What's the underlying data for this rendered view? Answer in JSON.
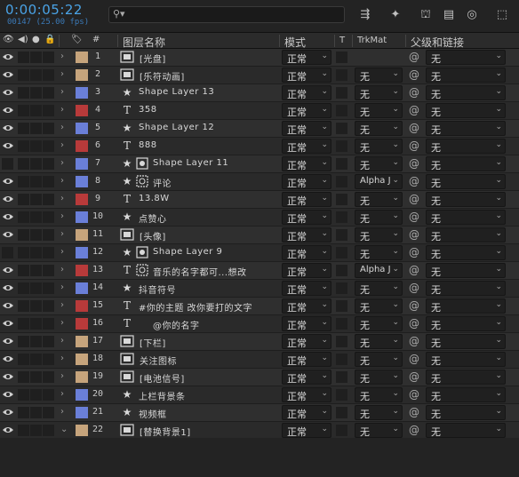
{
  "topbar": {
    "timecode": "0:00:05:22",
    "frameinfo": "00147 (25.00 fps)",
    "search_placeholder": "",
    "search_icon": "search-icon"
  },
  "header": {
    "label_col": "#",
    "layer_name": "图层名称",
    "mode": "模式",
    "t": "T",
    "trkmat": "TrkMat",
    "parent": "父级和链接"
  },
  "colors": {
    "tan": "#c6a47c",
    "blue": "#6a7fd8",
    "red": "#b83a3a",
    "accent": "#4aa3e6"
  },
  "layers": [
    {
      "num": "1",
      "name": "[光盘]",
      "type": "comp",
      "label": "tan",
      "mode": "正常",
      "trkmat": "",
      "parent": "无",
      "visible": true
    },
    {
      "num": "2",
      "name": "[乐符动画]",
      "type": "comp",
      "label": "tan",
      "mode": "正常",
      "trkmat": "无",
      "parent": "无",
      "visible": true
    },
    {
      "num": "3",
      "name": "Shape Layer 13",
      "type": "shape",
      "label": "blue",
      "mode": "正常",
      "trkmat": "无",
      "parent": "无",
      "visible": true
    },
    {
      "num": "4",
      "name": "358",
      "type": "text",
      "label": "red",
      "mode": "正常",
      "trkmat": "无",
      "parent": "无",
      "visible": true
    },
    {
      "num": "5",
      "name": "Shape Layer 12",
      "type": "shape",
      "label": "blue",
      "mode": "正常",
      "trkmat": "无",
      "parent": "无",
      "visible": true
    },
    {
      "num": "6",
      "name": "888",
      "type": "text",
      "label": "red",
      "mode": "正常",
      "trkmat": "无",
      "parent": "无",
      "visible": true
    },
    {
      "num": "7",
      "name": "Shape Layer 11",
      "type": "shape-matte",
      "label": "blue",
      "mode": "正常",
      "trkmat": "无",
      "parent": "无",
      "visible": false
    },
    {
      "num": "8",
      "name": "评论",
      "type": "shape-matted",
      "label": "blue",
      "mode": "正常",
      "trkmat": "Alpha J",
      "parent": "无",
      "visible": true
    },
    {
      "num": "9",
      "name": "13.8W",
      "type": "text",
      "label": "red",
      "mode": "正常",
      "trkmat": "无",
      "parent": "无",
      "visible": true
    },
    {
      "num": "10",
      "name": "点赞心",
      "type": "shape",
      "label": "blue",
      "mode": "正常",
      "trkmat": "无",
      "parent": "无",
      "visible": true
    },
    {
      "num": "11",
      "name": "[头像]",
      "type": "comp",
      "label": "tan",
      "mode": "正常",
      "trkmat": "无",
      "parent": "无",
      "visible": true
    },
    {
      "num": "12",
      "name": "Shape Layer 9",
      "type": "shape-matte",
      "label": "blue",
      "mode": "正常",
      "trkmat": "无",
      "parent": "无",
      "visible": false
    },
    {
      "num": "13",
      "name": "音乐的名字都可...想改",
      "type": "text-matted",
      "label": "red",
      "mode": "正常",
      "trkmat": "Alpha J",
      "parent": "无",
      "visible": true
    },
    {
      "num": "14",
      "name": "抖音符号",
      "type": "shape",
      "label": "blue",
      "mode": "正常",
      "trkmat": "无",
      "parent": "无",
      "visible": true
    },
    {
      "num": "15",
      "name": "#你的主题 改你要打的文字",
      "type": "text",
      "label": "red",
      "mode": "正常",
      "trkmat": "无",
      "parent": "无",
      "visible": true
    },
    {
      "num": "16",
      "name": "@你的名字",
      "type": "text",
      "label": "red",
      "mode": "正常",
      "trkmat": "无",
      "parent": "无",
      "visible": true
    },
    {
      "num": "17",
      "name": "[下栏]",
      "type": "comp",
      "label": "tan",
      "mode": "正常",
      "trkmat": "无",
      "parent": "无",
      "visible": true
    },
    {
      "num": "18",
      "name": "关注图标",
      "type": "comp",
      "label": "tan",
      "mode": "正常",
      "trkmat": "无",
      "parent": "无",
      "visible": true
    },
    {
      "num": "19",
      "name": "[电池信号]",
      "type": "comp",
      "label": "tan",
      "mode": "正常",
      "trkmat": "无",
      "parent": "无",
      "visible": true
    },
    {
      "num": "20",
      "name": "上栏背景条",
      "type": "shape",
      "label": "blue",
      "mode": "正常",
      "trkmat": "无",
      "parent": "无",
      "visible": true
    },
    {
      "num": "21",
      "name": "视频框",
      "type": "shape",
      "label": "blue",
      "mode": "正常",
      "trkmat": "无",
      "parent": "无",
      "visible": true
    },
    {
      "num": "22",
      "name": "[替换背景1]",
      "type": "comp",
      "label": "tan",
      "mode": "正常",
      "trkmat": "无",
      "parent": "无",
      "visible": true,
      "expanded": true
    }
  ]
}
